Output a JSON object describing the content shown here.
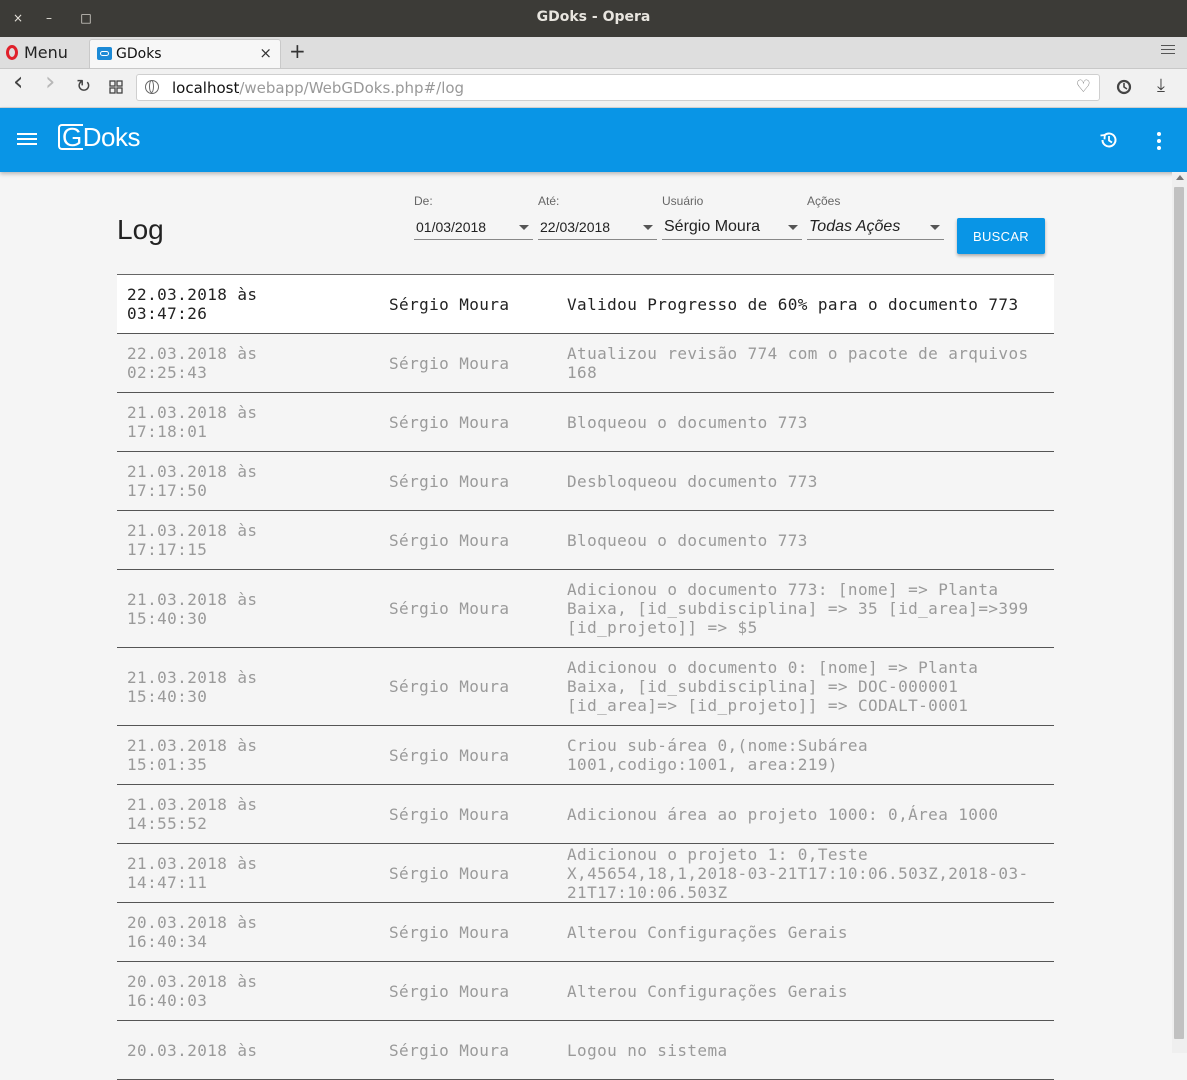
{
  "window": {
    "title": "GDoks - Opera",
    "close_glyph": "×",
    "minimize_glyph": "–",
    "maximize_glyph": "□"
  },
  "browser": {
    "menu_label": "Menu",
    "tab_title": "GDoks",
    "tab_close_glyph": "×",
    "new_tab_glyph": "+",
    "url_host": "localhost",
    "url_path": "/webapp/WebGDoks.php#/log",
    "back_glyph": "‹",
    "forward_glyph": "›",
    "reload_glyph": "↻",
    "download_glyph": "⤓",
    "heart_glyph": "♡"
  },
  "app": {
    "logo_g": "G",
    "logo_rest": "Doks",
    "brand_color": "#0995e6"
  },
  "filters": {
    "page_title": "Log",
    "de_label": "De:",
    "de_value": "01/03/2018",
    "ate_label": "Até:",
    "ate_value": "22/03/2018",
    "usuario_label": "Usuário",
    "usuario_value": "Sérgio Moura",
    "acoes_label": "Ações",
    "acoes_value": "Todas Ações",
    "search_button": "BUSCAR"
  },
  "log": [
    {
      "date": "22.03.2018 às 03:47:26",
      "user": "Sérgio Moura",
      "action": "Validou Progresso de 60% para o documento 773",
      "active": true
    },
    {
      "date": "22.03.2018 às 02:25:43",
      "user": "Sérgio Moura",
      "action": "Atualizou revisão 774 com o pacote de arquivos 168"
    },
    {
      "date": "21.03.2018 às 17:18:01",
      "user": "Sérgio Moura",
      "action": "Bloqueou o documento 773"
    },
    {
      "date": "21.03.2018 às 17:17:50",
      "user": "Sérgio Moura",
      "action": "Desbloqueou documento 773"
    },
    {
      "date": "21.03.2018 às 17:17:15",
      "user": "Sérgio Moura",
      "action": "Bloqueou o documento 773"
    },
    {
      "date": "21.03.2018 às 15:40:30",
      "user": "Sérgio Moura",
      "action": "Adicionou o documento 773: [nome] => Planta Baixa, [id_subdisciplina] => 35 [id_area]=>399 [id_projeto]] => $5"
    },
    {
      "date": "21.03.2018 às 15:40:30",
      "user": "Sérgio Moura",
      "action": "Adicionou o documento 0: [nome] => Planta Baixa, [id_subdisciplina] => DOC-000001 [id_area]=> [id_projeto]] => CODALT-0001"
    },
    {
      "date": "21.03.2018 às 15:01:35",
      "user": "Sérgio Moura",
      "action": "Criou sub-área 0,(nome:Subárea 1001,codigo:1001, area:219)"
    },
    {
      "date": "21.03.2018 às 14:55:52",
      "user": "Sérgio Moura",
      "action": "Adicionou área ao projeto 1000: 0,Área 1000"
    },
    {
      "date": "21.03.2018 às 14:47:11",
      "user": "Sérgio Moura",
      "action": "Adicionou o projeto 1: 0,Teste X,45654,18,1,2018-03-21T17:10:06.503Z,2018-03-21T17:10:06.503Z"
    },
    {
      "date": "20.03.2018 às 16:40:34",
      "user": "Sérgio Moura",
      "action": "Alterou Configurações Gerais"
    },
    {
      "date": "20.03.2018 às 16:40:03",
      "user": "Sérgio Moura",
      "action": "Alterou Configurações Gerais"
    },
    {
      "date": "20.03.2018 às",
      "user": "Sérgio Moura",
      "action": "Logou no sistema"
    }
  ]
}
